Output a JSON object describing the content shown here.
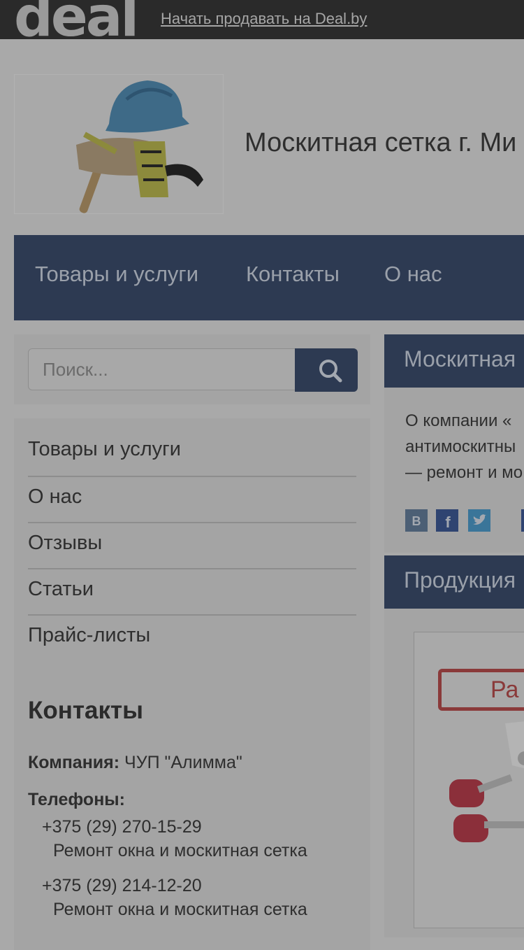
{
  "topbar": {
    "logo_text": "deal",
    "sell_link": "Начать продавать на Deal.by"
  },
  "header": {
    "site_title": "Москитная сетка г. Ми"
  },
  "main_nav": {
    "items": [
      {
        "label": "Товары и услуги"
      },
      {
        "label": "Контакты"
      },
      {
        "label": "О нас"
      }
    ]
  },
  "search": {
    "placeholder": "Поиск..."
  },
  "side_menu": {
    "items": [
      {
        "label": "Товары и услуги"
      },
      {
        "label": "О нас"
      },
      {
        "label": "Отзывы"
      },
      {
        "label": "Статьи"
      },
      {
        "label": "Прайс-листы"
      }
    ]
  },
  "contacts": {
    "heading": "Контакты",
    "company_label": "Компания:",
    "company_value": "ЧУП \"Алимма\"",
    "phones_label": "Телефоны:",
    "phones": [
      {
        "number": "+375 (29) 270-15-29",
        "note": "Ремонт окна и москитная сетка"
      },
      {
        "number": "+375 (29) 214-12-20",
        "note": "Ремонт окна и москитная сетка"
      }
    ]
  },
  "about": {
    "heading": "Москитная",
    "lines": [
      "О компании «",
      "антимоскитны",
      "— ремонт и мо"
    ]
  },
  "products": {
    "heading": "Продукция",
    "tile_banner_text": "Ра"
  },
  "colors": {
    "nav_bg": "#2d3a52",
    "topbar_bg": "#2a2a2a",
    "overlay_page_bg": "#a9a9a9"
  }
}
